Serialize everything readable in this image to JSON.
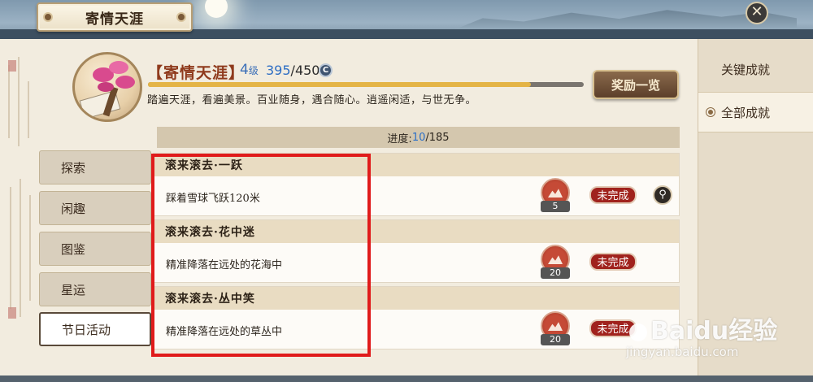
{
  "window": {
    "title": "寄情天涯"
  },
  "achievement": {
    "name": "【寄情天涯】",
    "level_num": "4",
    "level_unit": "级",
    "points_current": "395",
    "points_total": "/450",
    "currency_icon": "coin-icon",
    "progress_fraction": 0.878,
    "description": "踏遍天涯，看遍美景。百业随身，遇合随心。逍遥闲适，与世无争。",
    "reward_button": "奖励一览"
  },
  "progress": {
    "label": "进度:",
    "current": "10",
    "total": "/185"
  },
  "categories": [
    "探索",
    "闲趣",
    "图鉴",
    "星运",
    "节日活动"
  ],
  "active_category_index": 4,
  "right_tabs": [
    "关键成就",
    "全部成就"
  ],
  "active_right_tab_index": 1,
  "items": [
    {
      "title": "滚来滚去·一跃",
      "desc": "踩着雪球飞跃120米",
      "points": "5",
      "status": "未完成",
      "has_search": true
    },
    {
      "title": "滚来滚去·花中迷",
      "desc": "精准降落在远处的花海中",
      "points": "20",
      "status": "未完成",
      "has_search": false
    },
    {
      "title": "滚来滚去·丛中笑",
      "desc": "精准降落在远处的草丛中",
      "points": "20",
      "status": "未完成",
      "has_search": false
    }
  ],
  "watermark": {
    "main": "Baidu经验",
    "sub": "jingyan.baidu.com"
  },
  "colors": {
    "accent_red": "#a0221d",
    "highlight_box": "#e01b1b",
    "progress_fill": "#e4b446",
    "blue_value": "#2e6ec4"
  }
}
